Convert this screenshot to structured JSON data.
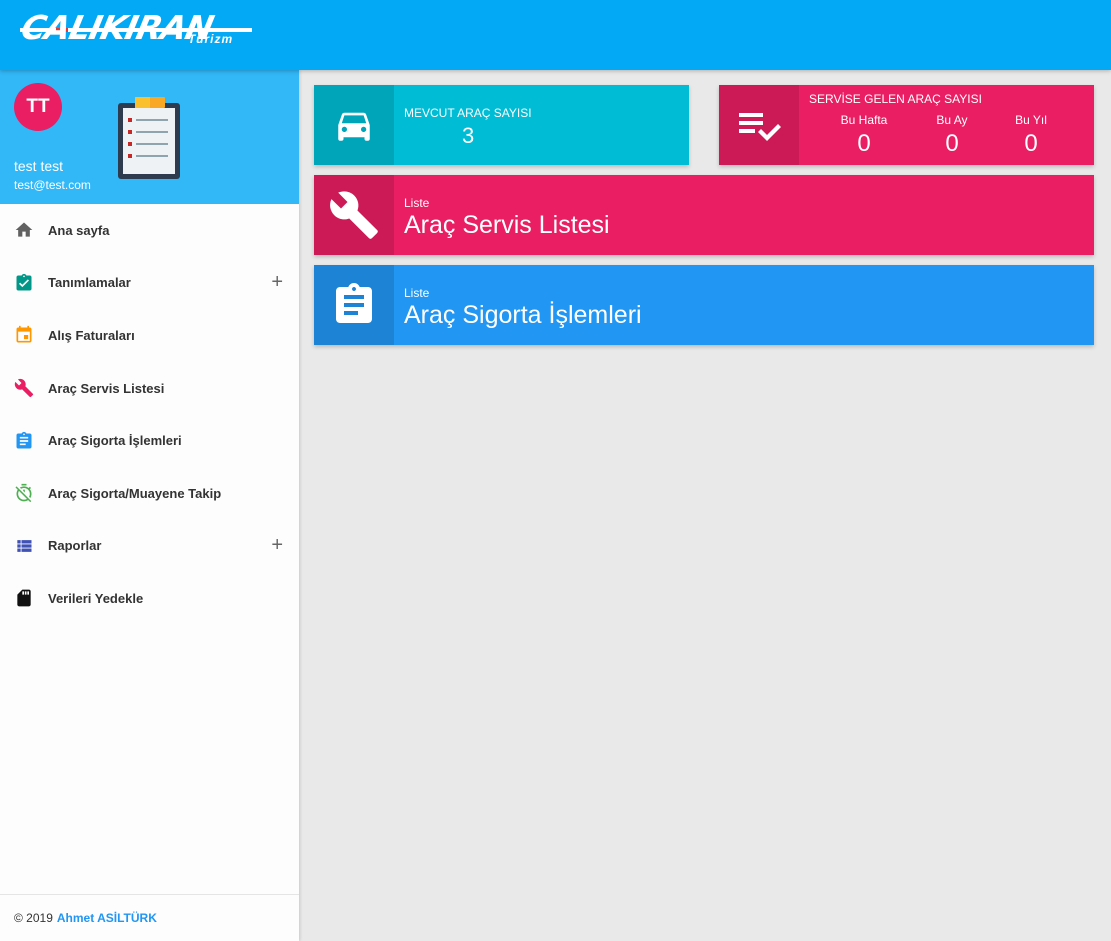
{
  "brand": {
    "name": "CALIKIRAN",
    "sub": "Turizm",
    "bar_color": "#03a9f4"
  },
  "user": {
    "initials": "TT",
    "name": "test test",
    "email": "test@test.com",
    "avatar_color": "#e91e63"
  },
  "menu": [
    {
      "label": "Ana sayfa",
      "icon": "home-icon",
      "color": "#616161",
      "expandable": false
    },
    {
      "label": "Tanımlamalar",
      "icon": "assignment-check-icon",
      "color": "#009688",
      "expandable": true
    },
    {
      "label": "Alış Faturaları",
      "icon": "calendar-icon",
      "color": "#ff9800",
      "expandable": false
    },
    {
      "label": "Araç Servis Listesi",
      "icon": "wrench-icon",
      "color": "#e91e63",
      "expandable": false
    },
    {
      "label": "Araç Sigorta İşlemleri",
      "icon": "assignment-icon",
      "color": "#2196f3",
      "expandable": false
    },
    {
      "label": "Araç Sigorta/Muayene Takip",
      "icon": "timer-off-icon",
      "color": "#4caf50",
      "expandable": false
    },
    {
      "label": "Raporlar",
      "icon": "list-icon",
      "color": "#3f51b5",
      "expandable": true
    },
    {
      "label": "Verileri Yedekle",
      "icon": "sd-card-icon",
      "color": "#111111",
      "expandable": false
    }
  ],
  "menu_plus": "+",
  "footer": {
    "copyright": "© 2019",
    "author": "Ahmet ASİLTÜRK"
  },
  "cards": {
    "cars": {
      "title": "MEVCUT ARAÇ SAYISI",
      "value": "3",
      "color": "#00bcd4"
    },
    "service": {
      "title": "SERVİSE GELEN ARAÇ SAYISI",
      "color": "#e91e63",
      "periods": [
        {
          "label": "Bu Hafta",
          "value": "0"
        },
        {
          "label": "Bu Ay",
          "value": "0"
        },
        {
          "label": "Bu Yıl",
          "value": "0"
        }
      ]
    },
    "servis_list": {
      "sub": "Liste",
      "title": "Araç Servis Listesi",
      "color": "#e91e63"
    },
    "sigorta_list": {
      "sub": "Liste",
      "title": "Araç Sigorta İşlemleri",
      "color": "#2196f3"
    }
  }
}
